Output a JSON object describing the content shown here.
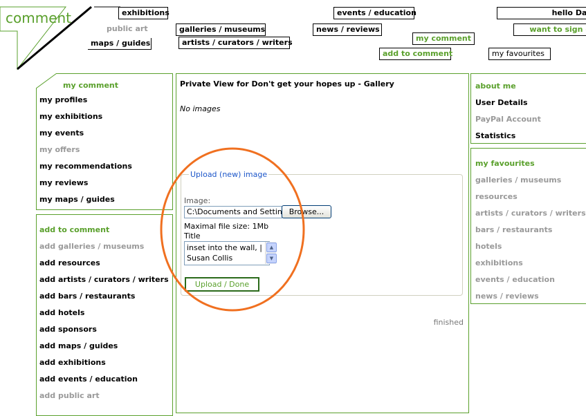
{
  "header": {
    "logo_text": "comment",
    "nav": {
      "exhibitions": "exhibitions",
      "public_art": "public art",
      "maps_guides": "maps / guides",
      "galleries_museums": "galleries / museums",
      "artists": "artists / curators / writers",
      "events_education": "events / education",
      "news_reviews": "news / reviews",
      "my_comment": "my comment",
      "add_to_comment": "add to comment",
      "hello": "hello Dave",
      "sign_out": "want to sign out",
      "my_favourites": "my favourites"
    }
  },
  "left": {
    "my_comment_heading": "my comment",
    "my_items": [
      "my profiles",
      "my exhibitions",
      "my events",
      "my offers",
      "my recommendations",
      "my reviews",
      "my maps / guides"
    ],
    "add_heading": "add to comment",
    "add_items": [
      "add galleries / museums",
      "add resources",
      "add artists / curators / writers",
      "add bars / restaurants",
      "add hotels",
      "add sponsors",
      "add maps / guides",
      "add exhibitions",
      "add events / education",
      "add public art"
    ]
  },
  "main": {
    "title": "Private View for Don't get your hopes up - Gallery",
    "no_images": "No images",
    "upload_legend": "Upload (new) image",
    "image_label": "Image:",
    "file_value": "C:\\Documents and Settings",
    "browse_label": "Browse...",
    "max_size": "Maximal file size: 1Mb",
    "title_label": "Title",
    "title_value_line1": "inset into the wall, |",
    "title_value_line2": "Susan Collis",
    "upload_done": "Upload / Done",
    "finished": "finished"
  },
  "right": {
    "about_heading": "about me",
    "about_items": [
      "User Details",
      "PayPal Account",
      "Statistics"
    ],
    "fav_heading": "my favourites",
    "fav_items": [
      "galleries / museums",
      "resources",
      "artists / curators / writers",
      "bars / restaurants",
      "hotels",
      "exhibitions",
      "events / education",
      "news / reviews"
    ]
  },
  "colors": {
    "accent": "#5aa02c",
    "highlight_circle": "#f07020",
    "link_blue": "#1c56c9"
  }
}
